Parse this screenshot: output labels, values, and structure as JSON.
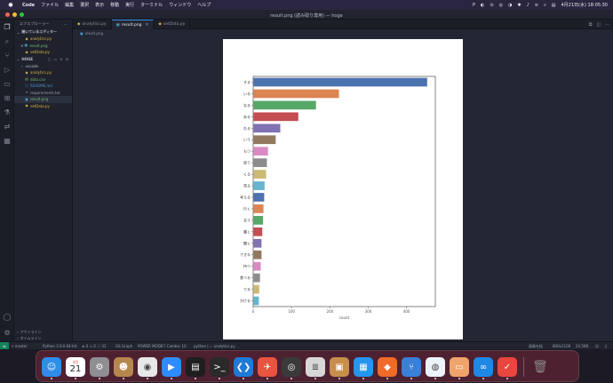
{
  "menubar": {
    "apple": "",
    "items": [
      "Code",
      "ファイル",
      "編集",
      "選択",
      "表示",
      "移動",
      "実行",
      "ターミナル",
      "ウィンドウ",
      "ヘルプ"
    ],
    "right_icons": [
      "P",
      "◐",
      "⊙",
      "◎",
      "◑",
      "✱",
      "♪",
      "≋",
      "⌕",
      "▤"
    ],
    "datetime": "4月21日(水)  18:05:30"
  },
  "window": {
    "title": "result.png (読み取り専用) — hoge"
  },
  "sidebar": {
    "header": "エクスプローラー",
    "open_editors_label": "開いているエディター",
    "open_editors": [
      {
        "name": "analytics.py",
        "kind": "py"
      },
      {
        "name": "result.png",
        "kind": "png",
        "prefix": "✕"
      },
      {
        "name": "setData.py",
        "kind": "py"
      }
    ],
    "project_label": "HOGE",
    "files": [
      {
        "name": ".vscode",
        "kind": "folder"
      },
      {
        "name": "analytics.py",
        "kind": "py"
      },
      {
        "name": "data.csv",
        "kind": "csv"
      },
      {
        "name": "README.md",
        "kind": "md"
      },
      {
        "name": "requirements.txt",
        "kind": "txt"
      },
      {
        "name": "result.png",
        "kind": "png"
      },
      {
        "name": "setData.py",
        "kind": "py"
      }
    ],
    "outline_label": "アウトライン",
    "timeline_label": "タイムライン"
  },
  "tabs": [
    {
      "label": "analytics.py",
      "kind": "py"
    },
    {
      "label": "result.png",
      "kind": "png"
    },
    {
      "label": "setData.py",
      "kind": "py"
    }
  ],
  "breadcrumb": {
    "file": "result.png"
  },
  "statusbar": {
    "branch": "master",
    "python": "Python 3.9.0 64-bit",
    "problems": "⊗ 0  ⚠ 0  ⓘ 31",
    "git_graph": "Git Graph",
    "power_mode": "POWER MODE!! Combo: 10",
    "python_file": "python | ✓ analytics.py",
    "image_size": "画像を拡",
    "dims": "800x1100",
    "file_size": "24.5KB"
  },
  "chart_data": {
    "type": "bar",
    "orientation": "horizontal",
    "categories": [
      "する",
      "いる",
      "なる",
      "ある",
      "れる",
      "いう",
      "もつ",
      "思う",
      "くる",
      "見る",
      "考える",
      "行く",
      "言う",
      "書く",
      "聞く",
      "できる",
      "持つ",
      "食べる",
      "でる",
      "かける"
    ],
    "values": [
      453,
      223,
      163,
      117,
      70,
      58,
      38,
      35,
      33,
      29,
      28,
      26,
      25,
      23,
      21,
      21,
      19,
      17,
      15,
      14
    ],
    "colors": [
      "#4c72b0",
      "#dd8452",
      "#55a868",
      "#c44e52",
      "#8172b3",
      "#937860",
      "#da8bc3",
      "#8c8c8c",
      "#ccb974",
      "#64b5cd",
      "#4c72b0",
      "#dd8452",
      "#55a868",
      "#c44e52",
      "#8172b3",
      "#937860",
      "#da8bc3",
      "#8c8c8c",
      "#ccb974",
      "#64b5cd"
    ],
    "xlabel": "count",
    "xticks": [
      0,
      100,
      200,
      300,
      400
    ],
    "xlim": [
      0,
      475
    ],
    "grid": false
  },
  "dock": {
    "calendar_month": "4月",
    "calendar_day": "21",
    "apps": [
      {
        "name": "finder-icon",
        "glyph": "☺",
        "color": "#2f8ce8"
      },
      {
        "name": "calendar-icon",
        "glyph": "",
        "color": "#ffffff"
      },
      {
        "name": "system-preferences-icon",
        "glyph": "⚙",
        "color": "#8e8e93"
      },
      {
        "name": "contacts-icon",
        "glyph": "☻",
        "color": "#b5874f"
      },
      {
        "name": "chrome-icon",
        "glyph": "◉",
        "color": "#e8e8e8"
      },
      {
        "name": "zoom-icon",
        "glyph": "▶",
        "color": "#2d8cff"
      },
      {
        "name": "activity-monitor-icon",
        "glyph": "▤",
        "color": "#1e1e1e"
      },
      {
        "name": "terminal-icon",
        "glyph": ">_",
        "color": "#2a2a2a"
      },
      {
        "name": "vscode-icon",
        "glyph": "❮❯",
        "color": "#1f7ad6"
      },
      {
        "name": "safari-icon",
        "glyph": "✈",
        "color": "#e8543f"
      },
      {
        "name": "quicktime-icon",
        "glyph": "◎",
        "color": "#3a3a3a"
      },
      {
        "name": "database-icon",
        "glyph": "≣",
        "color": "#d7d7d7"
      },
      {
        "name": "archive-icon",
        "glyph": "▣",
        "color": "#c78f4b"
      },
      {
        "name": "docker-icon",
        "glyph": "▦",
        "color": "#2496ed"
      },
      {
        "name": "sourcetree-icon",
        "glyph": "◆",
        "color": "#f06a2a"
      },
      {
        "name": "git-icon",
        "glyph": "⑂",
        "color": "#3b7fd6"
      },
      {
        "name": "postgres-icon",
        "glyph": "◍",
        "color": "#ecf3fb"
      },
      {
        "name": "preview-icon",
        "glyph": "▭",
        "color": "#f0a36b"
      },
      {
        "name": "infinity-icon",
        "glyph": "∞",
        "color": "#1e88e5"
      },
      {
        "name": "clock-icon",
        "glyph": "✓",
        "color": "#e8463f"
      }
    ],
    "trash": {
      "name": "trash-icon",
      "glyph": "🗑",
      "color": "#8a8a8a"
    }
  }
}
